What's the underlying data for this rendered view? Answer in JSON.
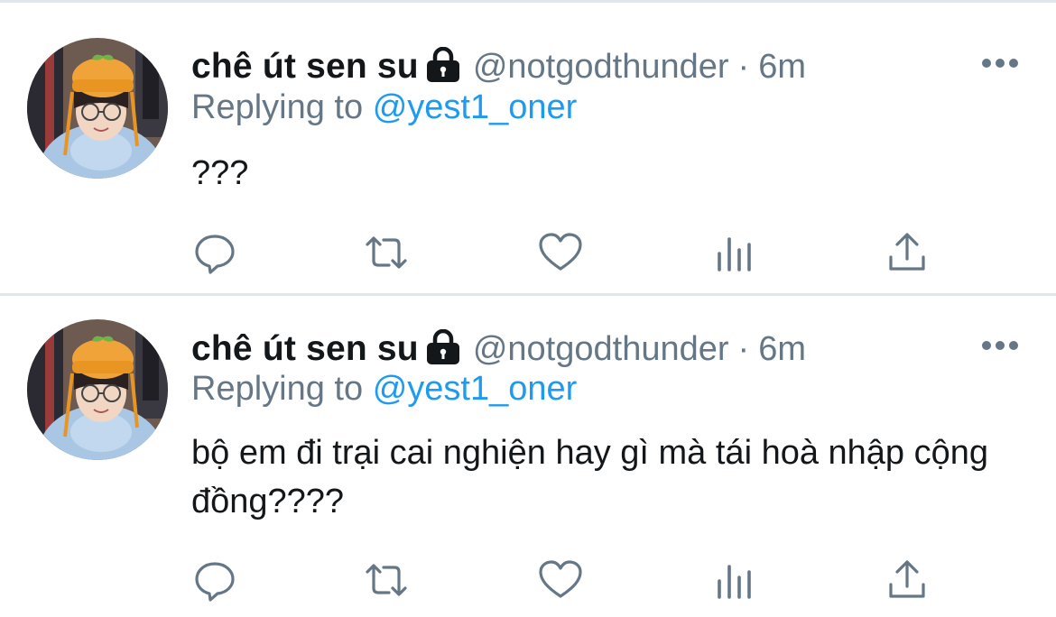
{
  "tweets": [
    {
      "display_name": "chê út sen su",
      "handle": "@notgodthunder",
      "separator": "·",
      "time": "6m",
      "replying_prefix": "Replying to",
      "replying_to": "@yest1_oner",
      "text": "???",
      "icons": [
        "lock-icon",
        "more-icon",
        "reply-icon",
        "retweet-icon",
        "like-icon",
        "analytics-icon",
        "share-icon"
      ]
    },
    {
      "display_name": "chê út sen su",
      "handle": "@notgodthunder",
      "separator": "·",
      "time": "6m",
      "replying_prefix": "Replying to",
      "replying_to": "@yest1_oner",
      "text": "bộ em đi trại cai nghiện hay gì mà tái hoà nhập cộng đồng????",
      "icons": [
        "lock-icon",
        "more-icon",
        "reply-icon",
        "retweet-icon",
        "like-icon",
        "analytics-icon",
        "share-icon"
      ]
    }
  ],
  "colors": {
    "text": "#14171a",
    "secondary": "#657786",
    "link": "#1d9bf0",
    "divider": "#e1e6ea"
  }
}
